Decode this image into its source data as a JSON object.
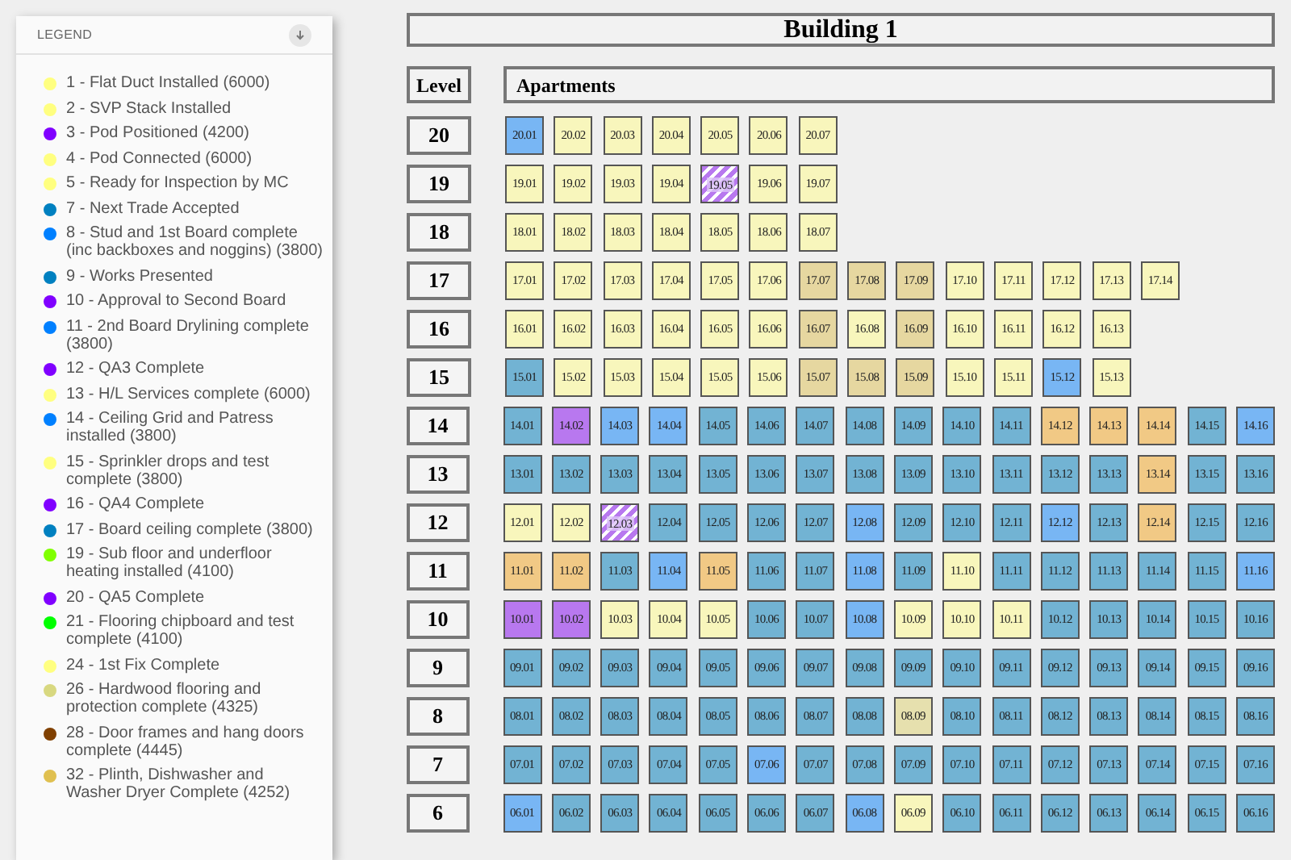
{
  "legend": {
    "title": "LEGEND",
    "items": [
      {
        "label": "1 - Flat Duct Installed (6000)",
        "color": "#ffff80"
      },
      {
        "label": "2 - SVP Stack Installed",
        "color": "#ffff80"
      },
      {
        "label": "3 - Pod Positioned (4200)",
        "color": "#8000ff"
      },
      {
        "label": "4 - Pod Connected (6000)",
        "color": "#ffff80"
      },
      {
        "label": "5 - Ready for Inspection by MC",
        "color": "#ffff80"
      },
      {
        "label": "7 - Next Trade Accepted",
        "color": "#0080c0"
      },
      {
        "label": "8 - Stud and 1st Board complete (inc backboxes and noggins) (3800)",
        "color": "#0080ff"
      },
      {
        "label": "9 - Works Presented",
        "color": "#0080c0"
      },
      {
        "label": "10 - Approval to Second Board",
        "color": "#8000ff"
      },
      {
        "label": "11 - 2nd Board Drylining complete (3800)",
        "color": "#0080ff"
      },
      {
        "label": "12 - QA3 Complete",
        "color": "#8000ff"
      },
      {
        "label": "13 - H/L Services complete (6000)",
        "color": "#ffff80"
      },
      {
        "label": "14 - Ceiling Grid and Patress installed (3800)",
        "color": "#0080ff"
      },
      {
        "label": "15 - Sprinkler drops and test complete (3800)",
        "color": "#ffff80"
      },
      {
        "label": "16 - QA4 Complete",
        "color": "#8000ff"
      },
      {
        "label": "17 - Board ceiling complete (3800)",
        "color": "#0080c0"
      },
      {
        "label": "19 - Sub floor and underfloor heating installed (4100)",
        "color": "#80ff00"
      },
      {
        "label": "20 - QA5 Complete",
        "color": "#8000ff"
      },
      {
        "label": "21 - Flooring chipboard and test complete (4100)",
        "color": "#00ff00"
      },
      {
        "label": "24 - 1st Fix Complete",
        "color": "#ffff80"
      },
      {
        "label": "26 - Hardwood flooring and protection complete (4325)",
        "color": "#d8d880"
      },
      {
        "label": "28 - Door frames and hang doors complete (4445)",
        "color": "#804000"
      },
      {
        "label": "32 - Plinth, Dishwasher and Washer Dryer Complete (4252)",
        "color": "#e0c050"
      }
    ]
  },
  "building": {
    "title": "Building 1",
    "level_header": "Level",
    "apartments_header": "Apartments"
  },
  "levels": [
    {
      "level": "20",
      "apartments": [
        {
          "label": "20.01",
          "color": "#78b6f4",
          "kind": "solid"
        },
        {
          "label": "20.02",
          "color": "#f8f6bc",
          "kind": "solid"
        },
        {
          "label": "20.03",
          "color": "#f8f6bc",
          "kind": "solid"
        },
        {
          "label": "20.04",
          "color": "#f8f6bc",
          "kind": "solid"
        },
        {
          "label": "20.05",
          "color": "#f8f6bc",
          "kind": "solid"
        },
        {
          "label": "20.06",
          "color": "#f8f6bc",
          "kind": "solid"
        },
        {
          "label": "20.07",
          "color": "#f8f6bc",
          "kind": "solid"
        }
      ]
    },
    {
      "level": "19",
      "apartments": [
        {
          "label": "19.01",
          "color": "#f8f6bc",
          "kind": "solid"
        },
        {
          "label": "19.02",
          "color": "#f8f6bc",
          "kind": "solid"
        },
        {
          "label": "19.03",
          "color": "#f8f6bc",
          "kind": "solid"
        },
        {
          "label": "19.04",
          "color": "#f8f6bc",
          "kind": "solid"
        },
        {
          "label": "19.05",
          "color": "#b878ef",
          "kind": "hatched"
        },
        {
          "label": "19.06",
          "color": "#f8f6bc",
          "kind": "solid"
        },
        {
          "label": "19.07",
          "color": "#f8f6bc",
          "kind": "solid"
        }
      ]
    },
    {
      "level": "18",
      "apartments": [
        {
          "label": "18.01",
          "color": "#f8f6bc",
          "kind": "solid"
        },
        {
          "label": "18.02",
          "color": "#f8f6bc",
          "kind": "solid"
        },
        {
          "label": "18.03",
          "color": "#f8f6bc",
          "kind": "solid"
        },
        {
          "label": "18.04",
          "color": "#f8f6bc",
          "kind": "solid"
        },
        {
          "label": "18.05",
          "color": "#f8f6bc",
          "kind": "solid"
        },
        {
          "label": "18.06",
          "color": "#f8f6bc",
          "kind": "solid"
        },
        {
          "label": "18.07",
          "color": "#f8f6bc",
          "kind": "solid"
        }
      ]
    },
    {
      "level": "17",
      "apartments": [
        {
          "label": "17.01",
          "color": "#f8f6bc",
          "kind": "solid"
        },
        {
          "label": "17.02",
          "color": "#f8f6bc",
          "kind": "solid"
        },
        {
          "label": "17.03",
          "color": "#f8f6bc",
          "kind": "solid"
        },
        {
          "label": "17.04",
          "color": "#f8f6bc",
          "kind": "solid"
        },
        {
          "label": "17.05",
          "color": "#f8f6bc",
          "kind": "solid"
        },
        {
          "label": "17.06",
          "color": "#f8f6bc",
          "kind": "solid"
        },
        {
          "label": "17.07",
          "color": "#e6d7a0",
          "kind": "solid"
        },
        {
          "label": "17.08",
          "color": "#e6d7a0",
          "kind": "solid"
        },
        {
          "label": "17.09",
          "color": "#e6d7a0",
          "kind": "solid"
        },
        {
          "label": "17.10",
          "color": "#f8f6bc",
          "kind": "solid"
        },
        {
          "label": "17.11",
          "color": "#f8f6bc",
          "kind": "solid"
        },
        {
          "label": "17.12",
          "color": "#f8f6bc",
          "kind": "solid"
        },
        {
          "label": "17.13",
          "color": "#f8f6bc",
          "kind": "solid"
        },
        {
          "label": "17.14",
          "color": "#f8f6bc",
          "kind": "solid"
        }
      ]
    },
    {
      "level": "16",
      "apartments": [
        {
          "label": "16.01",
          "color": "#f8f6bc",
          "kind": "solid"
        },
        {
          "label": "16.02",
          "color": "#f8f6bc",
          "kind": "solid"
        },
        {
          "label": "16.03",
          "color": "#f8f6bc",
          "kind": "solid"
        },
        {
          "label": "16.04",
          "color": "#f8f6bc",
          "kind": "solid"
        },
        {
          "label": "16.05",
          "color": "#f8f6bc",
          "kind": "solid"
        },
        {
          "label": "16.06",
          "color": "#f8f6bc",
          "kind": "solid"
        },
        {
          "label": "16.07",
          "color": "#e6d7a0",
          "kind": "solid"
        },
        {
          "label": "16.08",
          "color": "#f8f6bc",
          "kind": "solid"
        },
        {
          "label": "16.09",
          "color": "#e6d7a0",
          "kind": "solid"
        },
        {
          "label": "16.10",
          "color": "#f8f6bc",
          "kind": "solid"
        },
        {
          "label": "16.11",
          "color": "#f8f6bc",
          "kind": "solid"
        },
        {
          "label": "16.12",
          "color": "#f8f6bc",
          "kind": "solid"
        },
        {
          "label": "16.13",
          "color": "#f8f6bc",
          "kind": "solid"
        }
      ]
    },
    {
      "level": "15",
      "apartments": [
        {
          "label": "15.01",
          "color": "#72b3d3",
          "kind": "solid"
        },
        {
          "label": "15.02",
          "color": "#f8f6bc",
          "kind": "solid"
        },
        {
          "label": "15.03",
          "color": "#f8f6bc",
          "kind": "solid"
        },
        {
          "label": "15.04",
          "color": "#f8f6bc",
          "kind": "solid"
        },
        {
          "label": "15.05",
          "color": "#f8f6bc",
          "kind": "solid"
        },
        {
          "label": "15.06",
          "color": "#f8f6bc",
          "kind": "solid"
        },
        {
          "label": "15.07",
          "color": "#e6d7a0",
          "kind": "solid"
        },
        {
          "label": "15.08",
          "color": "#e6d7a0",
          "kind": "solid"
        },
        {
          "label": "15.09",
          "color": "#e6d7a0",
          "kind": "solid"
        },
        {
          "label": "15.10",
          "color": "#f8f6bc",
          "kind": "solid"
        },
        {
          "label": "15.11",
          "color": "#f8f6bc",
          "kind": "solid"
        },
        {
          "label": "15.12",
          "color": "#78b6f4",
          "kind": "solid"
        },
        {
          "label": "15.13",
          "color": "#f8f6bc",
          "kind": "solid"
        }
      ]
    },
    {
      "level": "14",
      "apartments": [
        {
          "label": "14.01",
          "color": "#72b3d3",
          "kind": "solid"
        },
        {
          "label": "14.02",
          "color": "#b878ef",
          "kind": "solid"
        },
        {
          "label": "14.03",
          "color": "#78b6f4",
          "kind": "solid"
        },
        {
          "label": "14.04",
          "color": "#78b6f4",
          "kind": "solid"
        },
        {
          "label": "14.05",
          "color": "#72b3d3",
          "kind": "solid"
        },
        {
          "label": "14.06",
          "color": "#72b3d3",
          "kind": "solid"
        },
        {
          "label": "14.07",
          "color": "#72b3d3",
          "kind": "solid"
        },
        {
          "label": "14.08",
          "color": "#72b3d3",
          "kind": "solid"
        },
        {
          "label": "14.09",
          "color": "#72b3d3",
          "kind": "solid"
        },
        {
          "label": "14.10",
          "color": "#72b3d3",
          "kind": "solid"
        },
        {
          "label": "14.11",
          "color": "#72b3d3",
          "kind": "solid"
        },
        {
          "label": "14.12",
          "color": "#f1c985",
          "kind": "solid"
        },
        {
          "label": "14.13",
          "color": "#f1c985",
          "kind": "solid"
        },
        {
          "label": "14.14",
          "color": "#f1c985",
          "kind": "solid"
        },
        {
          "label": "14.15",
          "color": "#72b3d3",
          "kind": "solid"
        },
        {
          "label": "14.16",
          "color": "#78b6f4",
          "kind": "solid"
        }
      ]
    },
    {
      "level": "13",
      "apartments": [
        {
          "label": "13.01",
          "color": "#72b3d3",
          "kind": "solid"
        },
        {
          "label": "13.02",
          "color": "#72b3d3",
          "kind": "solid"
        },
        {
          "label": "13.03",
          "color": "#72b3d3",
          "kind": "solid"
        },
        {
          "label": "13.04",
          "color": "#72b3d3",
          "kind": "solid"
        },
        {
          "label": "13.05",
          "color": "#72b3d3",
          "kind": "solid"
        },
        {
          "label": "13.06",
          "color": "#72b3d3",
          "kind": "solid"
        },
        {
          "label": "13.07",
          "color": "#72b3d3",
          "kind": "solid"
        },
        {
          "label": "13.08",
          "color": "#72b3d3",
          "kind": "solid"
        },
        {
          "label": "13.09",
          "color": "#72b3d3",
          "kind": "solid"
        },
        {
          "label": "13.10",
          "color": "#72b3d3",
          "kind": "solid"
        },
        {
          "label": "13.11",
          "color": "#72b3d3",
          "kind": "solid"
        },
        {
          "label": "13.12",
          "color": "#72b3d3",
          "kind": "solid"
        },
        {
          "label": "13.13",
          "color": "#72b3d3",
          "kind": "solid"
        },
        {
          "label": "13.14",
          "color": "#f1c985",
          "kind": "solid"
        },
        {
          "label": "13.15",
          "color": "#72b3d3",
          "kind": "solid"
        },
        {
          "label": "13.16",
          "color": "#72b3d3",
          "kind": "solid"
        }
      ]
    },
    {
      "level": "12",
      "apartments": [
        {
          "label": "12.01",
          "color": "#f8f6bc",
          "kind": "solid"
        },
        {
          "label": "12.02",
          "color": "#f8f6bc",
          "kind": "solid"
        },
        {
          "label": "12.03",
          "color": "#b878ef",
          "kind": "hatched"
        },
        {
          "label": "12.04",
          "color": "#72b3d3",
          "kind": "solid"
        },
        {
          "label": "12.05",
          "color": "#72b3d3",
          "kind": "solid"
        },
        {
          "label": "12.06",
          "color": "#72b3d3",
          "kind": "solid"
        },
        {
          "label": "12.07",
          "color": "#72b3d3",
          "kind": "solid"
        },
        {
          "label": "12.08",
          "color": "#78b6f4",
          "kind": "solid"
        },
        {
          "label": "12.09",
          "color": "#72b3d3",
          "kind": "solid"
        },
        {
          "label": "12.10",
          "color": "#72b3d3",
          "kind": "solid"
        },
        {
          "label": "12.11",
          "color": "#72b3d3",
          "kind": "solid"
        },
        {
          "label": "12.12",
          "color": "#78b6f4",
          "kind": "solid"
        },
        {
          "label": "12.13",
          "color": "#72b3d3",
          "kind": "solid"
        },
        {
          "label": "12.14",
          "color": "#f1c985",
          "kind": "solid"
        },
        {
          "label": "12.15",
          "color": "#72b3d3",
          "kind": "solid"
        },
        {
          "label": "12.16",
          "color": "#72b3d3",
          "kind": "solid"
        }
      ]
    },
    {
      "level": "11",
      "apartments": [
        {
          "label": "11.01",
          "color": "#f1c985",
          "kind": "solid"
        },
        {
          "label": "11.02",
          "color": "#f1c985",
          "kind": "solid"
        },
        {
          "label": "11.03",
          "color": "#72b3d3",
          "kind": "solid"
        },
        {
          "label": "11.04",
          "color": "#78b6f4",
          "kind": "solid"
        },
        {
          "label": "11.05",
          "color": "#f1c985",
          "kind": "solid"
        },
        {
          "label": "11.06",
          "color": "#72b3d3",
          "kind": "solid"
        },
        {
          "label": "11.07",
          "color": "#72b3d3",
          "kind": "solid"
        },
        {
          "label": "11.08",
          "color": "#78b6f4",
          "kind": "solid"
        },
        {
          "label": "11.09",
          "color": "#72b3d3",
          "kind": "solid"
        },
        {
          "label": "11.10",
          "color": "#f8f6bc",
          "kind": "solid"
        },
        {
          "label": "11.11",
          "color": "#72b3d3",
          "kind": "solid"
        },
        {
          "label": "11.12",
          "color": "#72b3d3",
          "kind": "solid"
        },
        {
          "label": "11.13",
          "color": "#72b3d3",
          "kind": "solid"
        },
        {
          "label": "11.14",
          "color": "#72b3d3",
          "kind": "solid"
        },
        {
          "label": "11.15",
          "color": "#72b3d3",
          "kind": "solid"
        },
        {
          "label": "11.16",
          "color": "#78b6f4",
          "kind": "solid"
        }
      ]
    },
    {
      "level": "10",
      "apartments": [
        {
          "label": "10.01",
          "color": "#b878ef",
          "kind": "solid"
        },
        {
          "label": "10.02",
          "color": "#b878ef",
          "kind": "solid"
        },
        {
          "label": "10.03",
          "color": "#f8f6bc",
          "kind": "solid"
        },
        {
          "label": "10.04",
          "color": "#f8f6bc",
          "kind": "solid"
        },
        {
          "label": "10.05",
          "color": "#f8f6bc",
          "kind": "solid"
        },
        {
          "label": "10.06",
          "color": "#72b3d3",
          "kind": "solid"
        },
        {
          "label": "10.07",
          "color": "#72b3d3",
          "kind": "solid"
        },
        {
          "label": "10.08",
          "color": "#78b6f4",
          "kind": "solid"
        },
        {
          "label": "10.09",
          "color": "#f8f6bc",
          "kind": "solid"
        },
        {
          "label": "10.10",
          "color": "#f8f6bc",
          "kind": "solid"
        },
        {
          "label": "10.11",
          "color": "#f8f6bc",
          "kind": "solid"
        },
        {
          "label": "10.12",
          "color": "#72b3d3",
          "kind": "solid"
        },
        {
          "label": "10.13",
          "color": "#72b3d3",
          "kind": "solid"
        },
        {
          "label": "10.14",
          "color": "#72b3d3",
          "kind": "solid"
        },
        {
          "label": "10.15",
          "color": "#72b3d3",
          "kind": "solid"
        },
        {
          "label": "10.16",
          "color": "#72b3d3",
          "kind": "solid"
        }
      ]
    },
    {
      "level": "9",
      "apartments": [
        {
          "label": "09.01",
          "color": "#72b3d3",
          "kind": "solid"
        },
        {
          "label": "09.02",
          "color": "#72b3d3",
          "kind": "solid"
        },
        {
          "label": "09.03",
          "color": "#72b3d3",
          "kind": "solid"
        },
        {
          "label": "09.04",
          "color": "#72b3d3",
          "kind": "solid"
        },
        {
          "label": "09.05",
          "color": "#72b3d3",
          "kind": "solid"
        },
        {
          "label": "09.06",
          "color": "#72b3d3",
          "kind": "solid"
        },
        {
          "label": "09.07",
          "color": "#72b3d3",
          "kind": "solid"
        },
        {
          "label": "09.08",
          "color": "#72b3d3",
          "kind": "solid"
        },
        {
          "label": "09.09",
          "color": "#72b3d3",
          "kind": "solid"
        },
        {
          "label": "09.10",
          "color": "#72b3d3",
          "kind": "solid"
        },
        {
          "label": "09.11",
          "color": "#72b3d3",
          "kind": "solid"
        },
        {
          "label": "09.12",
          "color": "#72b3d3",
          "kind": "solid"
        },
        {
          "label": "09.13",
          "color": "#72b3d3",
          "kind": "solid"
        },
        {
          "label": "09.14",
          "color": "#72b3d3",
          "kind": "solid"
        },
        {
          "label": "09.15",
          "color": "#72b3d3",
          "kind": "solid"
        },
        {
          "label": "09.16",
          "color": "#72b3d3",
          "kind": "solid"
        }
      ]
    },
    {
      "level": "8",
      "apartments": [
        {
          "label": "08.01",
          "color": "#72b3d3",
          "kind": "solid"
        },
        {
          "label": "08.02",
          "color": "#72b3d3",
          "kind": "solid"
        },
        {
          "label": "08.03",
          "color": "#72b3d3",
          "kind": "solid"
        },
        {
          "label": "08.04",
          "color": "#72b3d3",
          "kind": "solid"
        },
        {
          "label": "08.05",
          "color": "#72b3d3",
          "kind": "solid"
        },
        {
          "label": "08.06",
          "color": "#72b3d3",
          "kind": "solid"
        },
        {
          "label": "08.07",
          "color": "#72b3d3",
          "kind": "solid"
        },
        {
          "label": "08.08",
          "color": "#72b3d3",
          "kind": "solid"
        },
        {
          "label": "08.09",
          "color": "#e6e0ae",
          "kind": "solid"
        },
        {
          "label": "08.10",
          "color": "#72b3d3",
          "kind": "solid"
        },
        {
          "label": "08.11",
          "color": "#72b3d3",
          "kind": "solid"
        },
        {
          "label": "08.12",
          "color": "#72b3d3",
          "kind": "solid"
        },
        {
          "label": "08.13",
          "color": "#72b3d3",
          "kind": "solid"
        },
        {
          "label": "08.14",
          "color": "#72b3d3",
          "kind": "solid"
        },
        {
          "label": "08.15",
          "color": "#72b3d3",
          "kind": "solid"
        },
        {
          "label": "08.16",
          "color": "#72b3d3",
          "kind": "solid"
        }
      ]
    },
    {
      "level": "7",
      "apartments": [
        {
          "label": "07.01",
          "color": "#72b3d3",
          "kind": "solid"
        },
        {
          "label": "07.02",
          "color": "#72b3d3",
          "kind": "solid"
        },
        {
          "label": "07.03",
          "color": "#72b3d3",
          "kind": "solid"
        },
        {
          "label": "07.04",
          "color": "#72b3d3",
          "kind": "solid"
        },
        {
          "label": "07.05",
          "color": "#72b3d3",
          "kind": "solid"
        },
        {
          "label": "07.06",
          "color": "#78b6f4",
          "kind": "solid"
        },
        {
          "label": "07.07",
          "color": "#72b3d3",
          "kind": "solid"
        },
        {
          "label": "07.08",
          "color": "#72b3d3",
          "kind": "solid"
        },
        {
          "label": "07.09",
          "color": "#72b3d3",
          "kind": "solid"
        },
        {
          "label": "07.10",
          "color": "#72b3d3",
          "kind": "solid"
        },
        {
          "label": "07.11",
          "color": "#72b3d3",
          "kind": "solid"
        },
        {
          "label": "07.12",
          "color": "#72b3d3",
          "kind": "solid"
        },
        {
          "label": "07.13",
          "color": "#72b3d3",
          "kind": "solid"
        },
        {
          "label": "07.14",
          "color": "#72b3d3",
          "kind": "solid"
        },
        {
          "label": "07.15",
          "color": "#72b3d3",
          "kind": "solid"
        },
        {
          "label": "07.16",
          "color": "#72b3d3",
          "kind": "solid"
        }
      ]
    },
    {
      "level": "6",
      "apartments": [
        {
          "label": "06.01",
          "color": "#78b6f4",
          "kind": "solid"
        },
        {
          "label": "06.02",
          "color": "#72b3d3",
          "kind": "solid"
        },
        {
          "label": "06.03",
          "color": "#72b3d3",
          "kind": "solid"
        },
        {
          "label": "06.04",
          "color": "#72b3d3",
          "kind": "solid"
        },
        {
          "label": "06.05",
          "color": "#72b3d3",
          "kind": "solid"
        },
        {
          "label": "06.06",
          "color": "#72b3d3",
          "kind": "solid"
        },
        {
          "label": "06.07",
          "color": "#72b3d3",
          "kind": "solid"
        },
        {
          "label": "06.08",
          "color": "#78b6f4",
          "kind": "solid"
        },
        {
          "label": "06.09",
          "color": "#f8f6bc",
          "kind": "solid"
        },
        {
          "label": "06.10",
          "color": "#72b3d3",
          "kind": "solid"
        },
        {
          "label": "06.11",
          "color": "#72b3d3",
          "kind": "solid"
        },
        {
          "label": "06.12",
          "color": "#72b3d3",
          "kind": "solid"
        },
        {
          "label": "06.13",
          "color": "#72b3d3",
          "kind": "solid"
        },
        {
          "label": "06.14",
          "color": "#72b3d3",
          "kind": "solid"
        },
        {
          "label": "06.15",
          "color": "#72b3d3",
          "kind": "solid"
        },
        {
          "label": "06.16",
          "color": "#72b3d3",
          "kind": "solid"
        }
      ]
    }
  ]
}
